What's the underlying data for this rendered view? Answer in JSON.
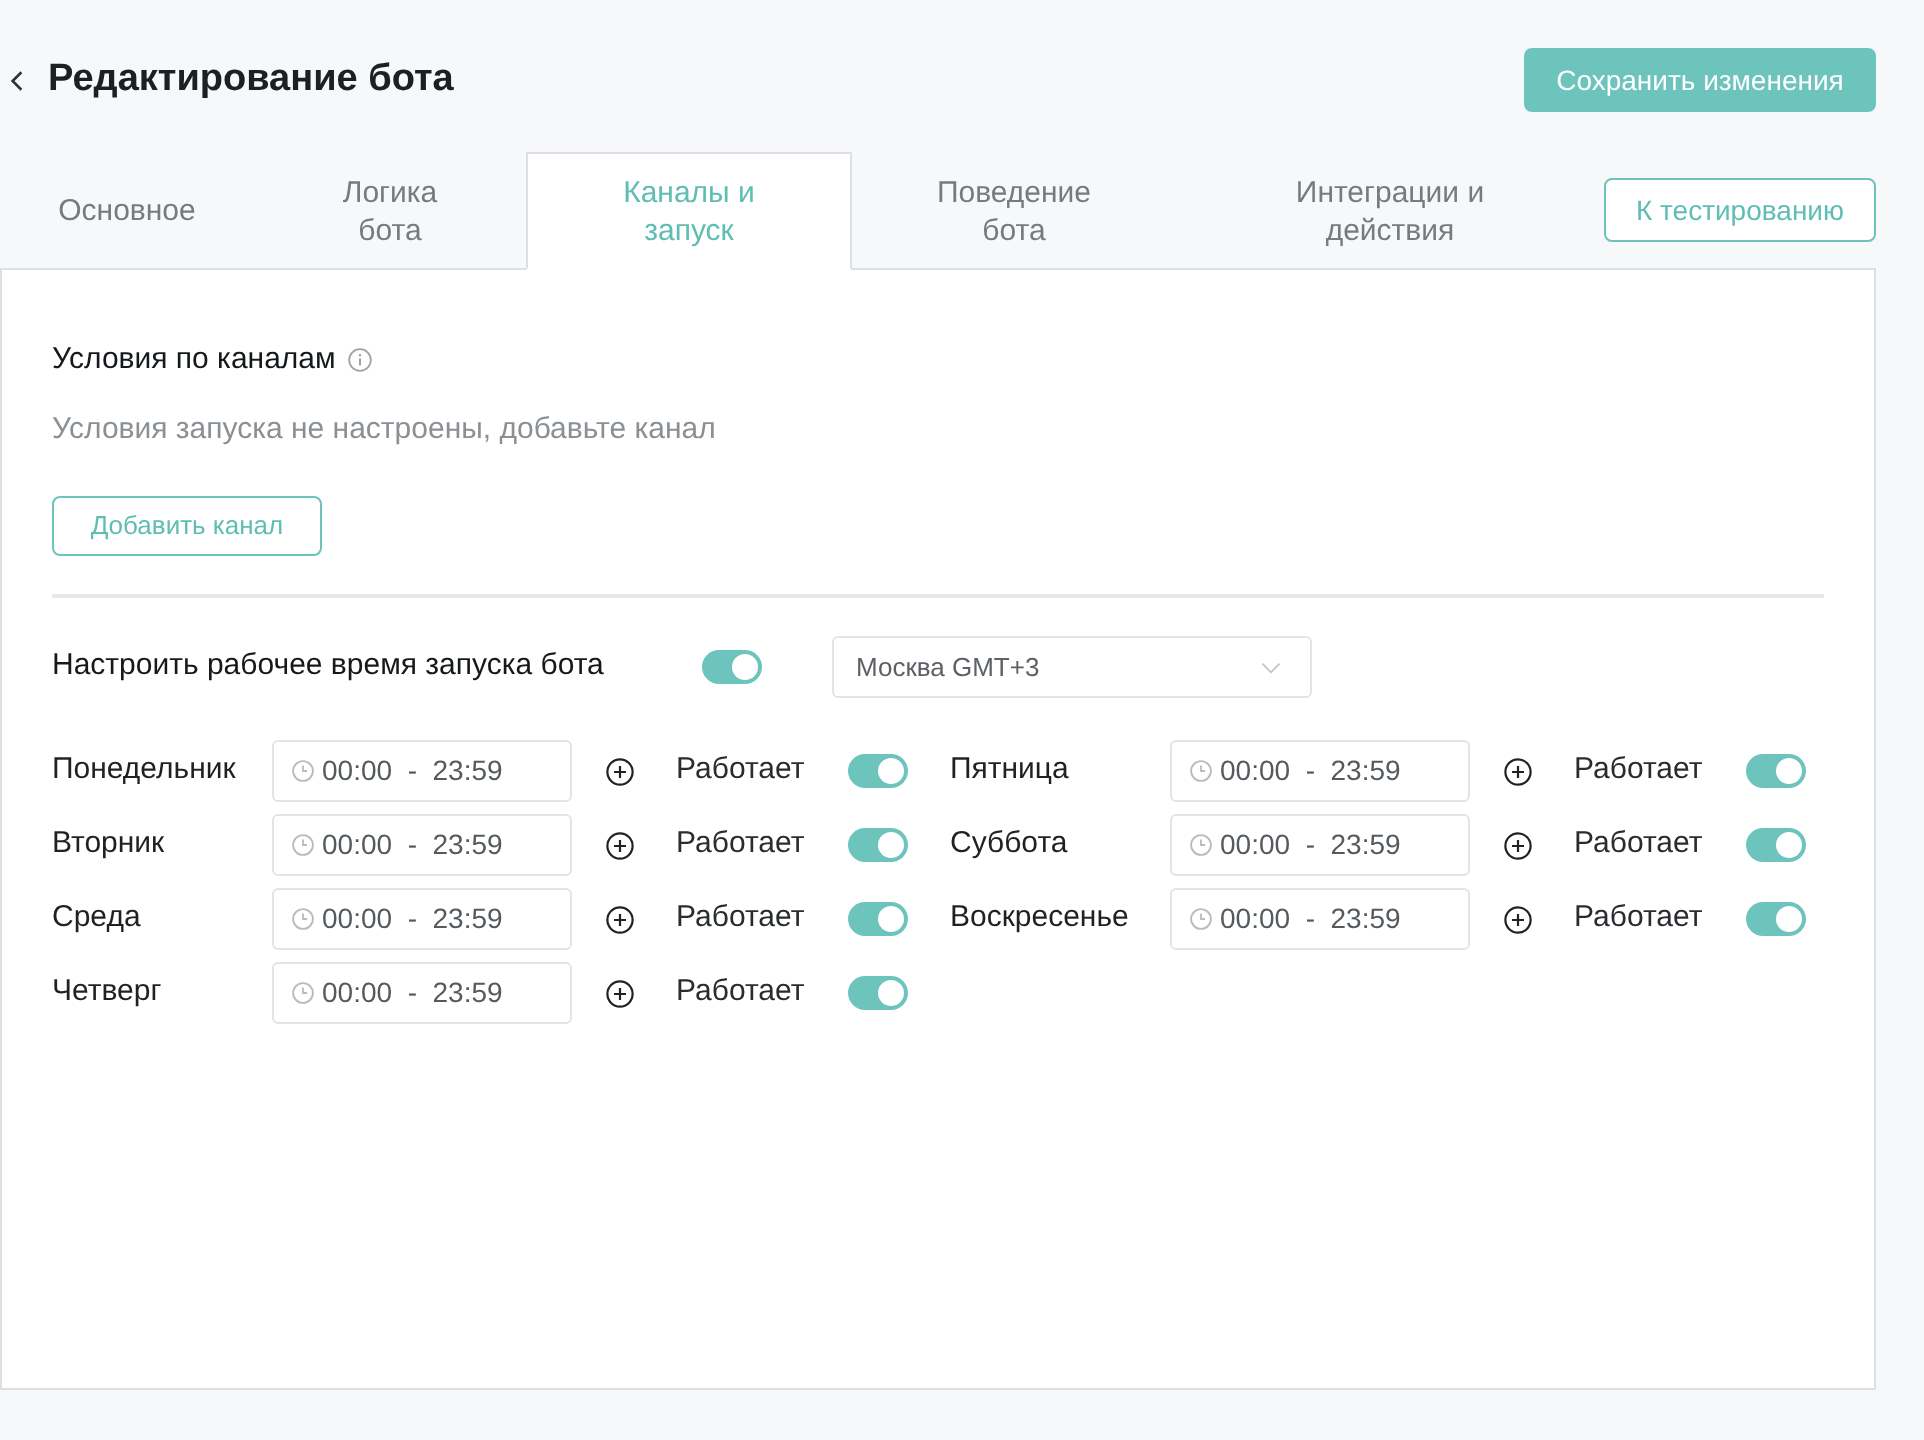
{
  "header": {
    "title": "Редактирование бота",
    "save_button": "Сохранить изменения"
  },
  "tabs": [
    {
      "label": "Основное",
      "selected": false
    },
    {
      "label": "Логика бота",
      "selected": false
    },
    {
      "label": "Каналы и запуск",
      "selected": true
    },
    {
      "label": "Поведение бота",
      "selected": false
    },
    {
      "label": "Интеграции и действия",
      "selected": false
    }
  ],
  "test_button": "К тестированию",
  "channels": {
    "title": "Условия по каналам",
    "empty_text": "Условия запуска не настроены, добавьте канал",
    "add_button": "Добавить канал"
  },
  "work_time": {
    "label": "Настроить рабочее время запуска бота",
    "on": true,
    "timezone": "Москва GMT+3"
  },
  "days": [
    {
      "name": "Понедельник",
      "time": "00:00  -  23:59",
      "status": "Работает",
      "on": true
    },
    {
      "name": "Вторник",
      "time": "00:00  -  23:59",
      "status": "Работает",
      "on": true
    },
    {
      "name": "Среда",
      "time": "00:00  -  23:59",
      "status": "Работает",
      "on": true
    },
    {
      "name": "Четверг",
      "time": "00:00  -  23:59",
      "status": "Работает",
      "on": true
    },
    {
      "name": "Пятница",
      "time": "00:00  -  23:59",
      "status": "Работает",
      "on": true
    },
    {
      "name": "Суббота",
      "time": "00:00  -  23:59",
      "status": "Работает",
      "on": true
    },
    {
      "name": "Воскресенье",
      "time": "00:00  -  23:59",
      "status": "Работает",
      "on": true
    }
  ]
}
